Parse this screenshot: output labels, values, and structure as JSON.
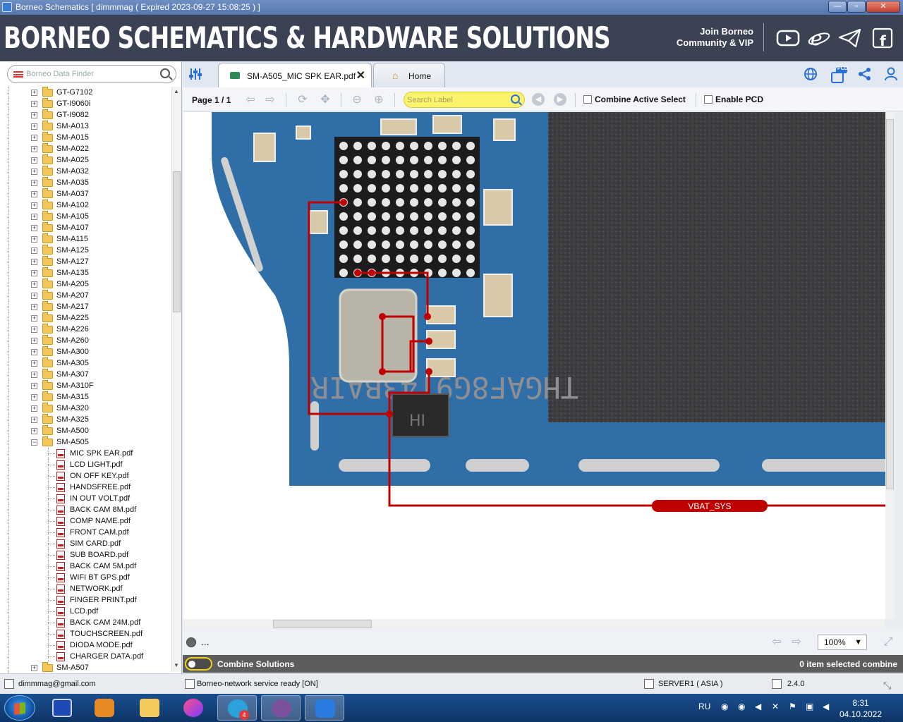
{
  "window": {
    "title": "Borneo Schematics [ dimmmag ( Expired 2023-09-27 15:08:25 ) ]",
    "minimize": "—",
    "maximize": "▫",
    "close": "✕"
  },
  "banner": {
    "brand": "BORNEO SCHEMATICS & HARDWARE SOLUTIONS",
    "join_line1": "Join Borneo",
    "join_line2": "Community & VIP",
    "icons": [
      "youtube-icon",
      "browser-e-icon",
      "telegram-icon",
      "facebook-icon"
    ]
  },
  "sidebar": {
    "search_placeholder": "Borneo Data Finder",
    "models": [
      "GT-G7102",
      "GT-I9060i",
      "GT-I9082",
      "SM-A013",
      "SM-A015",
      "SM-A022",
      "SM-A025",
      "SM-A032",
      "SM-A035",
      "SM-A037",
      "SM-A102",
      "SM-A105",
      "SM-A107",
      "SM-A115",
      "SM-A125",
      "SM-A127",
      "SM-A135",
      "SM-A205",
      "SM-A207",
      "SM-A217",
      "SM-A225",
      "SM-A226",
      "SM-A260",
      "SM-A300",
      "SM-A305",
      "SM-A307",
      "SM-A310F",
      "SM-A315",
      "SM-A320",
      "SM-A325",
      "SM-A500"
    ],
    "expanded_model": "SM-A505",
    "files": [
      "MIC SPK EAR.pdf",
      "LCD LIGHT.pdf",
      "ON OFF KEY.pdf",
      "HANDSFREE.pdf",
      "IN OUT VOLT.pdf",
      "BACK CAM 8M.pdf",
      "COMP NAME.pdf",
      "FRONT CAM.pdf",
      "SIM CARD.pdf",
      "SUB BOARD.pdf",
      "BACK CAM 5M.pdf",
      "WIFI BT GPS.pdf",
      "NETWORK.pdf",
      "FINGER PRINT.pdf",
      "LCD.pdf",
      "BACK CAM 24M.pdf",
      "TOUCHSCREEN.pdf",
      "DIODA MODE.pdf",
      "CHARGER DATA.pdf"
    ],
    "last_model": "SM-A507",
    "expand_glyph": "+",
    "collapse_glyph": "−"
  },
  "tabs": {
    "active_label": "SM-A505_MIC SPK EAR.pdf",
    "close_glyph": "✕",
    "home_label": "Home"
  },
  "toolbar": {
    "page": "Page 1 / 1",
    "search_placeholder": "Search Label",
    "combine_active_select": "Combine Active Select",
    "enable_pcd": "Enable PCD",
    "pcd_badge": "PCD"
  },
  "viewer": {
    "chip_marking": "THGAF8G9T43BAIR",
    "ic_marking": "HI",
    "net_label": "VBAT_SYS"
  },
  "status": {
    "dots": "...",
    "zoom": "100%",
    "combine_label": "Combine Solutions",
    "combine_count": "0 item selected combine",
    "email": "dimmmag@gmail.com",
    "service": "Borneo-network service ready [ON]",
    "server": "SERVER1 ( ASIA )",
    "version": "2.4.0"
  },
  "taskbar": {
    "lang": "RU",
    "telegram_badge": "4",
    "time": "8:31",
    "date": "04.10.2022"
  },
  "colors": {
    "banner_bg": "#3a4254",
    "accent_blue": "#2a6fd6",
    "trace_red": "#c00000",
    "search_yellow": "#fbf36a",
    "pcb_blue": "#2f6ea6"
  }
}
